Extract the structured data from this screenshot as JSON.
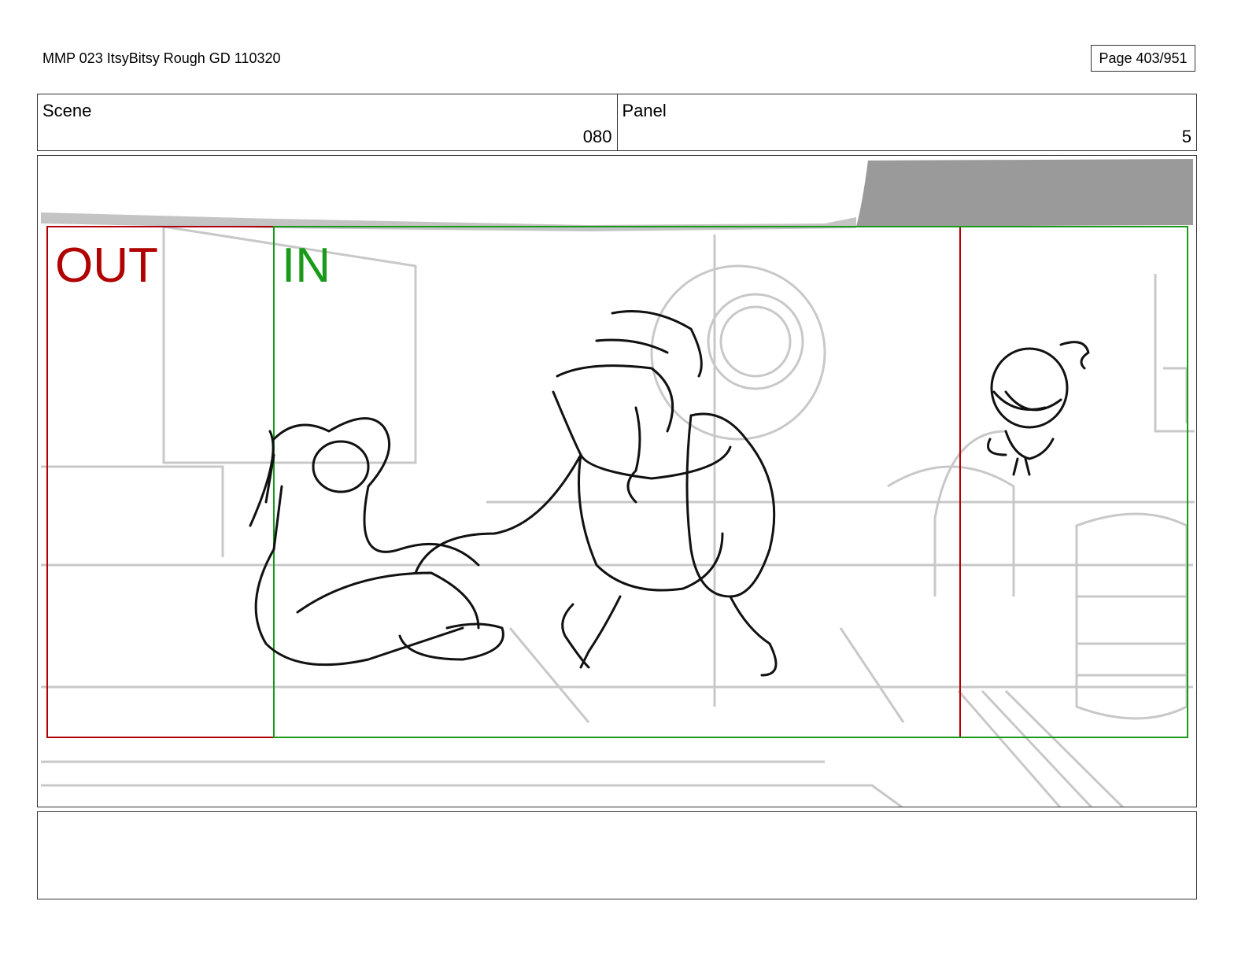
{
  "header": {
    "document_title": "MMP 023 ItsyBitsy Rough GD 110320",
    "page_label": "Page 403/951"
  },
  "scene": {
    "label": "Scene",
    "value": "080"
  },
  "panel": {
    "label": "Panel",
    "value": "5"
  },
  "frame": {
    "out_label": "OUT",
    "in_label": "IN",
    "colors": {
      "out": "#b00000",
      "in": "#1a9a1a",
      "sketch": "#111111",
      "background_lines": "#c8c8c8",
      "sky_shape": "#9a9a9a"
    }
  },
  "notes": {
    "text": ""
  }
}
